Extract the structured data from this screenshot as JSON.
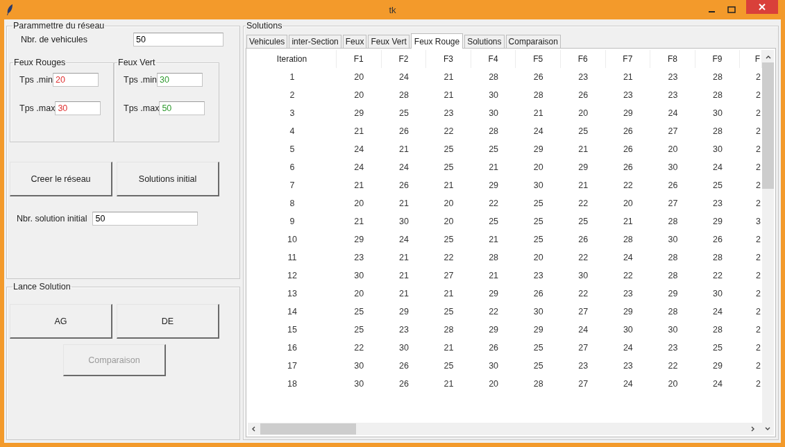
{
  "window": {
    "title": "tk"
  },
  "network": {
    "title": "Parammettre du réseau",
    "vehicles": {
      "label": "Nbr. de vehicules",
      "value": "50"
    },
    "light_groups": [
      {
        "title": "Feux Rouges",
        "color": "#e03030",
        "fields": [
          {
            "label": "Tps .min",
            "value": "20"
          },
          {
            "label": "Tps .max",
            "value": "30"
          }
        ]
      },
      {
        "title": "Feux Vert",
        "color": "#2f9a2f",
        "fields": [
          {
            "label": "Tps .min",
            "value": "30"
          },
          {
            "label": "Tps .max",
            "value": "50"
          }
        ]
      }
    ],
    "buttons": [
      {
        "label": "Creer le réseau",
        "disabled": false
      },
      {
        "label": "Solutions initial",
        "disabled": false
      }
    ],
    "initial": {
      "label": "Nbr. solution initial",
      "value": "50"
    }
  },
  "launch": {
    "title": "Lance Solution",
    "buttons": [
      {
        "label": "AG",
        "disabled": false
      },
      {
        "label": "DE",
        "disabled": false
      },
      {
        "label": "Comparaison",
        "disabled": true
      }
    ]
  },
  "solutions": {
    "title": "Solutions",
    "tabs": [
      {
        "label": "Vehicules",
        "selected": false
      },
      {
        "label": "inter-Section",
        "selected": false
      },
      {
        "label": "Feux",
        "selected": false
      },
      {
        "label": "Feux Vert",
        "selected": false
      },
      {
        "label": "Feux Rouge",
        "selected": true
      },
      {
        "label": "Solutions",
        "selected": false
      },
      {
        "label": "Comparaison",
        "selected": false
      }
    ],
    "table": {
      "columns": [
        "Iteration",
        "F1",
        "F2",
        "F3",
        "F4",
        "F5",
        "F6",
        "F7",
        "F8",
        "F9",
        "F"
      ],
      "rows": [
        [
          "1",
          "20",
          "24",
          "21",
          "28",
          "26",
          "23",
          "21",
          "23",
          "28",
          "2"
        ],
        [
          "2",
          "20",
          "28",
          "21",
          "30",
          "28",
          "26",
          "23",
          "23",
          "28",
          "2"
        ],
        [
          "3",
          "29",
          "25",
          "23",
          "30",
          "21",
          "20",
          "29",
          "24",
          "30",
          "2"
        ],
        [
          "4",
          "21",
          "26",
          "22",
          "28",
          "24",
          "25",
          "26",
          "27",
          "28",
          "2"
        ],
        [
          "5",
          "24",
          "21",
          "25",
          "25",
          "29",
          "21",
          "26",
          "20",
          "30",
          "2"
        ],
        [
          "6",
          "24",
          "24",
          "25",
          "21",
          "20",
          "29",
          "26",
          "30",
          "24",
          "2"
        ],
        [
          "7",
          "21",
          "26",
          "21",
          "29",
          "30",
          "21",
          "22",
          "26",
          "25",
          "2"
        ],
        [
          "8",
          "20",
          "21",
          "20",
          "22",
          "25",
          "22",
          "20",
          "27",
          "23",
          "2"
        ],
        [
          "9",
          "21",
          "30",
          "20",
          "25",
          "25",
          "25",
          "21",
          "28",
          "29",
          "3"
        ],
        [
          "10",
          "29",
          "24",
          "25",
          "21",
          "25",
          "26",
          "28",
          "30",
          "26",
          "2"
        ],
        [
          "11",
          "23",
          "21",
          "22",
          "28",
          "20",
          "22",
          "24",
          "28",
          "28",
          "2"
        ],
        [
          "12",
          "30",
          "21",
          "27",
          "21",
          "23",
          "30",
          "22",
          "28",
          "22",
          "2"
        ],
        [
          "13",
          "20",
          "21",
          "21",
          "29",
          "26",
          "22",
          "23",
          "29",
          "30",
          "2"
        ],
        [
          "14",
          "25",
          "29",
          "25",
          "22",
          "30",
          "27",
          "29",
          "28",
          "24",
          "2"
        ],
        [
          "15",
          "25",
          "23",
          "28",
          "29",
          "29",
          "24",
          "30",
          "30",
          "28",
          "2"
        ],
        [
          "16",
          "22",
          "30",
          "21",
          "26",
          "25",
          "27",
          "24",
          "23",
          "25",
          "2"
        ],
        [
          "17",
          "30",
          "26",
          "25",
          "30",
          "25",
          "23",
          "23",
          "22",
          "29",
          "2"
        ],
        [
          "18",
          "30",
          "26",
          "21",
          "20",
          "28",
          "27",
          "24",
          "20",
          "24",
          "2"
        ]
      ]
    }
  }
}
